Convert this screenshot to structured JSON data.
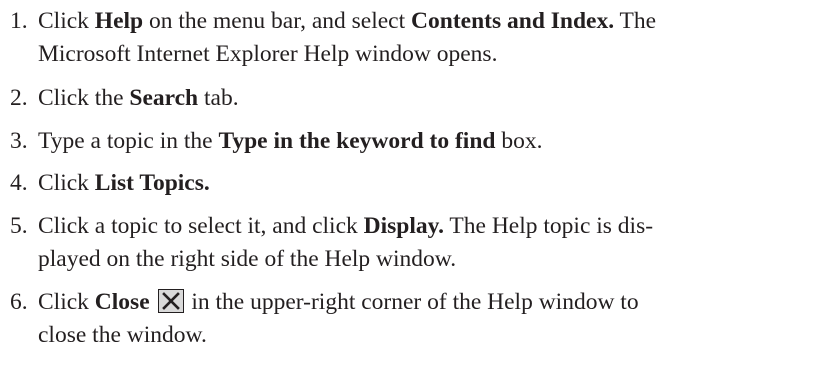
{
  "steps": [
    {
      "number": "1.",
      "line1": {
        "t1": "Click ",
        "b1": "Help",
        "t2": " on the menu bar, and select ",
        "b2": "Contents and Index.",
        "t3": " The"
      },
      "line2": "Microsoft Internet Explorer Help window opens."
    },
    {
      "number": "2.",
      "t1": "Click the ",
      "b1": "Search",
      "t2": " tab."
    },
    {
      "number": "3.",
      "t1": "Type a topic in the ",
      "b1": "Type in the keyword to find",
      "t2": " box."
    },
    {
      "number": "4.",
      "t1": "Click ",
      "b1": "List Topics."
    },
    {
      "number": "5.",
      "line1": {
        "t1": "Click a topic to select it, and click ",
        "b1": "Display.",
        "t2": " The Help topic is dis-"
      },
      "line2": "played on the right side of the Help window."
    },
    {
      "number": "6.",
      "line1": {
        "t1": "Click ",
        "b1": "Close",
        "t2": " in the upper-right corner of the Help window to"
      },
      "line2": "close the window.",
      "icon": "close-x-icon"
    }
  ]
}
